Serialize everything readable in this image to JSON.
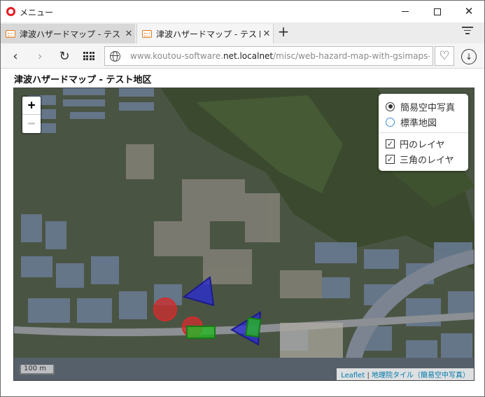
{
  "titlebar": {
    "menu_label": "メニュー"
  },
  "tabs": [
    {
      "title": "津波ハザードマップ - テスト地区",
      "close": "✕"
    },
    {
      "title": "津波ハザードマップ - テスト地区",
      "close": "✕"
    }
  ],
  "toolbar": {
    "url_prefix": "www.koutou-software.",
    "url_host": "net.localnet",
    "url_path": "/misc/web-hazard-map-with-gsimaps-a"
  },
  "page": {
    "title": "津波ハザードマップ - テスト地区"
  },
  "map": {
    "zoom_in": "+",
    "zoom_out": "−",
    "base_layers": [
      {
        "label": "簡易空中写真",
        "selected": true
      },
      {
        "label": "標準地図",
        "selected": false
      }
    ],
    "overlays": [
      {
        "label": "円のレイヤ",
        "checked": true
      },
      {
        "label": "三角のレイヤ",
        "checked": true
      }
    ],
    "scale_label": "100 m",
    "attribution": {
      "leaflet": "Leaflet",
      "separator": " | ",
      "tiles": "地理院タイル（簡易空中写真）"
    },
    "colors": {
      "circle": "#d22c2c",
      "triangle": "#2b2bd6",
      "rect": "#26b526"
    }
  }
}
